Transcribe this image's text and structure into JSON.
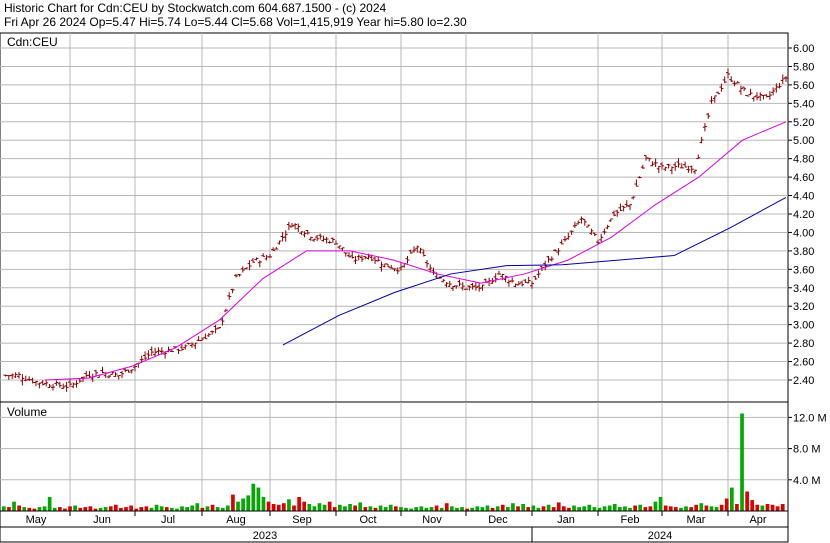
{
  "header": {
    "line1": "Historic Chart for Cdn:CEU by Stockwatch.com 604.687.1500 - (c) 2024",
    "line2": "Fri Apr 26 2024   Op=5.47   Hi=5.74   Lo=5.44   Cl=5.68   Vol=1,415,919   Year hi=5.80   lo=2.30"
  },
  "colors": {
    "price_bar": "#8b0000",
    "ma_short": "#e000e0",
    "ma_long": "#0000aa",
    "volume_up": "#00aa00",
    "volume_down": "#dd0000",
    "grid": "#b8b8b8"
  },
  "chart_data": [
    {
      "type": "line",
      "title": "Cdn:CEU",
      "ylim": [
        2.2,
        6.1
      ],
      "y_ticks": [
        "6.00",
        "5.80",
        "5.60",
        "5.40",
        "5.20",
        "5.00",
        "4.80",
        "4.60",
        "4.40",
        "4.20",
        "4.00",
        "3.80",
        "3.60",
        "3.40",
        "3.20",
        "3.00",
        "2.80",
        "2.60",
        "2.40"
      ],
      "months": [
        "May",
        "Jun",
        "Jul",
        "Aug",
        "Sep",
        "Oct",
        "Nov",
        "Dec",
        "Jan",
        "Feb",
        "Mar",
        "Apr"
      ],
      "years": [
        "2023",
        "2024"
      ],
      "price_close": [
        [
          "May",
          2.45
        ],
        [
          "May",
          2.38
        ],
        [
          "May",
          2.35
        ],
        [
          "May",
          2.33
        ],
        [
          "Jun",
          2.45
        ],
        [
          "Jun",
          2.48
        ],
        [
          "Jun",
          2.45
        ],
        [
          "Jun",
          2.55
        ],
        [
          "Jul",
          2.7
        ],
        [
          "Jul",
          2.72
        ],
        [
          "Jul",
          2.75
        ],
        [
          "Jul",
          2.85
        ],
        [
          "Aug",
          2.95
        ],
        [
          "Aug",
          3.5
        ],
        [
          "Aug",
          3.68
        ],
        [
          "Aug",
          3.75
        ],
        [
          "Sep",
          4.1
        ],
        [
          "Sep",
          3.95
        ],
        [
          "Sep",
          3.9
        ],
        [
          "Oct",
          3.7
        ],
        [
          "Oct",
          3.75
        ],
        [
          "Oct",
          3.65
        ],
        [
          "Oct",
          3.6
        ],
        [
          "Nov",
          3.85
        ],
        [
          "Nov",
          3.55
        ],
        [
          "Nov",
          3.45
        ],
        [
          "Nov",
          3.4
        ],
        [
          "Dec",
          3.4
        ],
        [
          "Dec",
          3.55
        ],
        [
          "Dec",
          3.45
        ],
        [
          "Dec",
          3.45
        ],
        [
          "Jan",
          3.7
        ],
        [
          "Jan",
          3.9
        ],
        [
          "Jan",
          4.15
        ],
        [
          "Jan",
          3.9
        ],
        [
          "Feb",
          4.2
        ],
        [
          "Feb",
          4.3
        ],
        [
          "Feb",
          4.8
        ],
        [
          "Feb",
          4.7
        ],
        [
          "Mar",
          4.72
        ],
        [
          "Mar",
          4.7
        ],
        [
          "Mar",
          5.4
        ],
        [
          "Mar",
          5.7
        ],
        [
          "Apr",
          5.5
        ],
        [
          "Apr",
          5.45
        ],
        [
          "Apr",
          5.68
        ]
      ],
      "ma_short": [
        2.4,
        2.42,
        2.55,
        2.75,
        3.05,
        3.5,
        3.8,
        3.8,
        3.7,
        3.55,
        3.45,
        3.55,
        3.7,
        3.95,
        4.3,
        4.6,
        5.0,
        5.2
      ],
      "ma_long": [
        2.78,
        3.1,
        3.35,
        3.55,
        3.64,
        3.65,
        3.7,
        3.75,
        4.05,
        4.38
      ]
    },
    {
      "type": "bar",
      "title": "Volume",
      "ylim": [
        0,
        14
      ],
      "y_ticks": [
        "12.0 M",
        "8.0 M",
        "4.0 M"
      ],
      "volume_m": [
        0.6,
        0.5,
        1.2,
        0.7,
        0.5,
        0.4,
        0.3,
        0.5,
        0.6,
        1.8,
        0.4,
        0.5,
        0.3,
        0.6,
        0.7,
        0.4,
        0.5,
        0.6,
        0.3,
        0.4,
        0.5,
        0.6,
        0.8,
        0.4,
        0.5,
        0.7,
        0.3,
        0.5,
        0.6,
        0.4,
        0.8,
        0.6,
        0.5,
        0.4,
        0.3,
        0.6,
        0.5,
        0.7,
        1.0,
        0.4,
        0.6,
        0.8,
        0.5,
        0.4,
        0.7,
        2.1,
        1.2,
        1.6,
        2.0,
        3.5,
        3.0,
        1.8,
        1.2,
        0.9,
        0.8,
        1.0,
        1.5,
        0.7,
        1.8,
        1.2,
        0.9,
        0.6,
        1.0,
        0.8,
        1.2,
        0.5,
        0.8,
        0.6,
        0.9,
        0.7,
        1.1,
        0.5,
        0.6,
        0.4,
        0.7,
        0.5,
        0.8,
        0.6,
        0.5,
        0.4,
        0.3,
        0.5,
        0.6,
        0.4,
        0.5,
        0.7,
        0.4,
        1.0,
        0.6,
        0.4,
        0.5,
        0.3,
        0.4,
        0.6,
        0.5,
        0.7,
        0.4,
        0.6,
        0.8,
        0.5,
        1.0,
        0.6,
        0.9,
        0.5,
        0.7,
        0.4,
        0.6,
        0.8,
        0.5,
        1.1,
        0.6,
        0.4,
        0.7,
        0.5,
        0.6,
        0.8,
        0.5,
        0.4,
        0.6,
        0.7,
        0.9,
        0.5,
        0.6,
        0.4,
        0.7,
        0.8,
        0.5,
        0.6,
        1.2,
        1.8,
        0.7,
        0.6,
        0.5,
        0.4,
        0.6,
        0.5,
        0.8,
        1.0,
        0.7,
        0.6,
        0.5,
        0.8,
        1.6,
        3.0,
        0.9,
        12.5,
        2.5,
        1.4,
        0.8,
        0.7,
        0.9,
        0.8,
        0.6,
        0.9
      ]
    }
  ]
}
